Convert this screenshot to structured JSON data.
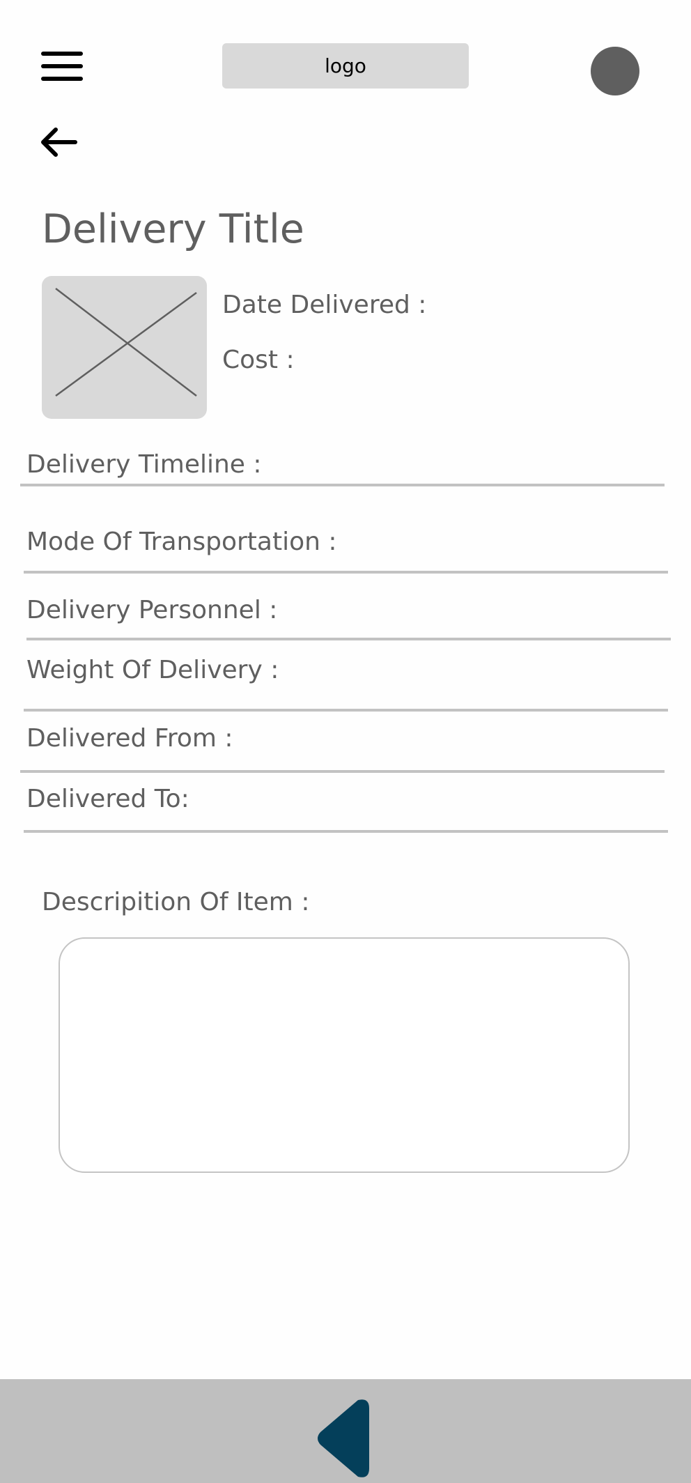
{
  "header": {
    "logo_text": "logo",
    "menu_icon": "hamburger-menu-icon",
    "avatar_icon": "user-avatar"
  },
  "nav": {
    "back_icon": "arrow-left-icon"
  },
  "delivery": {
    "title": "Delivery Title",
    "image_placeholder_icon": "image-placeholder-icon",
    "date_delivered_label": "Date Delivered :",
    "cost_label": "Cost :"
  },
  "fields": [
    {
      "label": "Delivery Timeline :"
    },
    {
      "label": "Mode Of Transportation :"
    },
    {
      "label": "Delivery Personnel :"
    },
    {
      "label": "Weight Of Delivery :"
    },
    {
      "label": "Delivered From :"
    },
    {
      "label": "Delivered To:"
    }
  ],
  "description": {
    "label": "Descripition Of Item :",
    "value": ""
  },
  "bottom_bar": {
    "back_icon": "triangle-back-icon",
    "accent_color": "#043f5a"
  }
}
